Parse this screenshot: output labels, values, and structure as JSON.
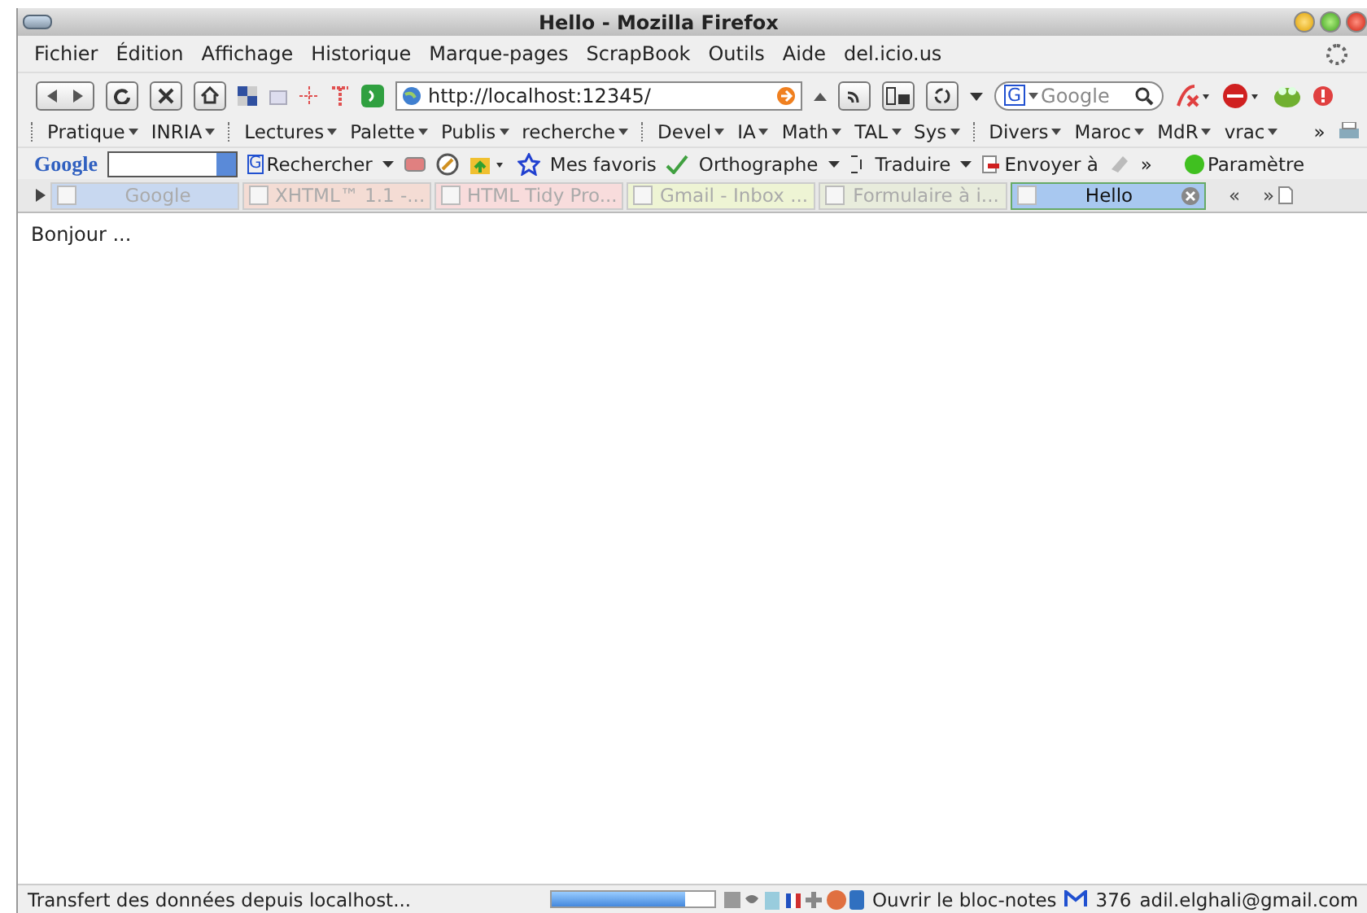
{
  "window": {
    "title": "Hello - Mozilla Firefox"
  },
  "menu": [
    "Fichier",
    "Édition",
    "Affichage",
    "Historique",
    "Marque-pages",
    "ScrapBook",
    "Outils",
    "Aide",
    "del.icio.us"
  ],
  "navigation": {
    "url": "http://localhost:12345/",
    "search_engine": "G",
    "search_placeholder": "Google"
  },
  "bookmark_groups": [
    [
      "Pratique",
      "INRIA"
    ],
    [
      "Lectures",
      "Palette",
      "Publis",
      "recherche"
    ],
    [
      "Devel",
      "IA",
      "Math",
      "TAL",
      "Sys"
    ],
    [
      "Divers",
      "Maroc",
      "MdR",
      "vrac"
    ]
  ],
  "bookmarks_more": "»",
  "google_toolbar": {
    "logo": "Google",
    "search_letter": "G",
    "search": "Rechercher",
    "favorites": "Mes favoris",
    "spelling": "Orthographe",
    "translate": "Traduire",
    "send": "Envoyer à",
    "more": "»",
    "settings": "Paramètre"
  },
  "tabs": [
    {
      "label": "Google",
      "selected": false,
      "color": "#c8d8f0"
    },
    {
      "label": "XHTML™ 1.1 -...",
      "selected": false,
      "color": "#f4dcd4"
    },
    {
      "label": "HTML Tidy Pro...",
      "selected": false,
      "color": "#f8dcdc"
    },
    {
      "label": "Gmail - Inbox ...",
      "selected": false,
      "color": "#eef4d4"
    },
    {
      "label": "Formulaire à i...",
      "selected": false,
      "color": "#e8ecdc"
    },
    {
      "label": "Hello",
      "selected": true,
      "color": "#a8c8f0"
    }
  ],
  "tab_scroll": [
    "«",
    "»"
  ],
  "content": {
    "text": "Bonjour ..."
  },
  "status_bar": {
    "text": "Transfert des données depuis localhost...",
    "level": 0.82,
    "notepad": "Ouvrir le bloc-notes",
    "mail_count": "376",
    "account": "adil.elghali@gmail.com"
  }
}
